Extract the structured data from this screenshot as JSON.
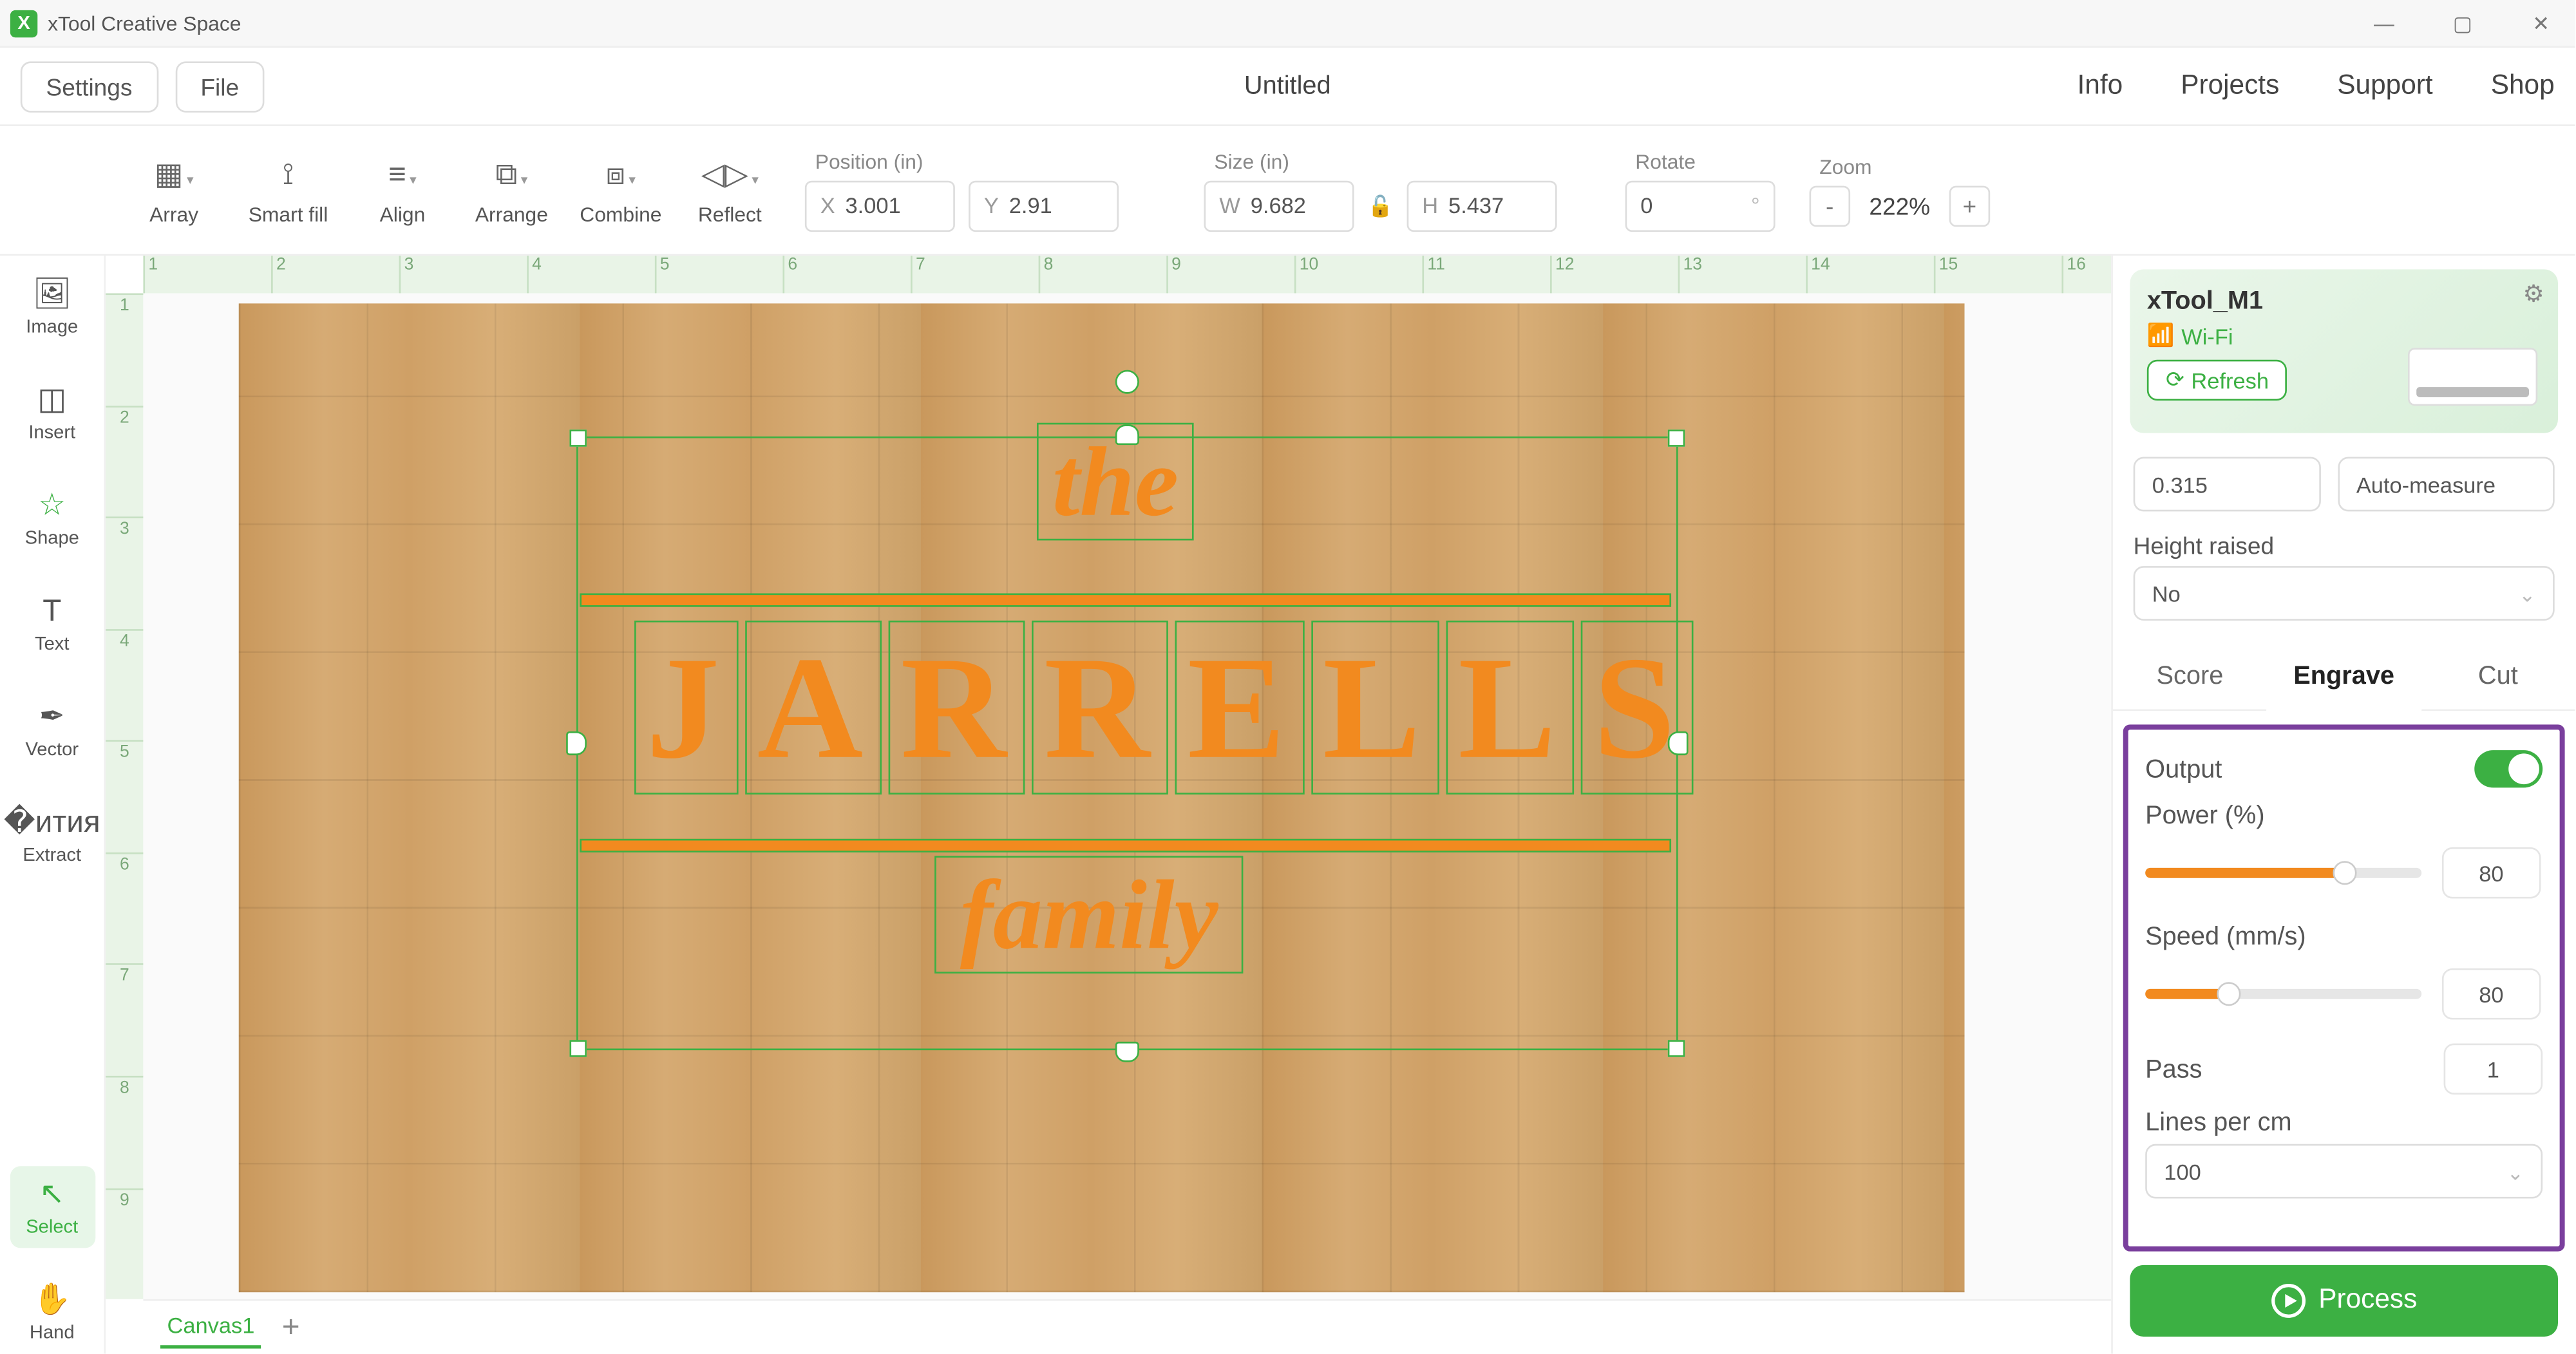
{
  "titlebar": {
    "app_name": "xTool Creative Space"
  },
  "menubar": {
    "settings": "Settings",
    "file": "File",
    "doc_title": "Untitled",
    "links": {
      "info": "Info",
      "projects": "Projects",
      "support": "Support",
      "shop": "Shop"
    }
  },
  "toolbar": {
    "array": "Array",
    "smartfill": "Smart fill",
    "align": "Align",
    "arrange": "Arrange",
    "combine": "Combine",
    "reflect": "Reflect",
    "position_label": "Position (in)",
    "pos_x_prefix": "X",
    "pos_x": "3.001",
    "pos_y_prefix": "Y",
    "pos_y": "2.91",
    "size_label": "Size (in)",
    "size_w_prefix": "W",
    "size_w": "9.682",
    "size_h_prefix": "H",
    "size_h": "5.437",
    "rotate_label": "Rotate",
    "rotate_val": "0",
    "rotate_unit": "°",
    "zoom_label": "Zoom",
    "zoom_val": "222%"
  },
  "lefttools": {
    "image": "Image",
    "insert": "Insert",
    "shape": "Shape",
    "text": "Text",
    "vector": "Vector",
    "extract": "Extract",
    "select": "Select",
    "hand": "Hand"
  },
  "ruler_h": [
    "1",
    "2",
    "3",
    "4",
    "5",
    "6",
    "7",
    "8",
    "9",
    "10",
    "11",
    "12",
    "13",
    "14",
    "15",
    "16"
  ],
  "ruler_v": [
    "1",
    "2",
    "3",
    "4",
    "5",
    "6",
    "7",
    "8",
    "9"
  ],
  "canvas": {
    "text_the": "the",
    "text_main_letters": [
      "J",
      "A",
      "R",
      "R",
      "E",
      "L",
      "L",
      "S"
    ],
    "text_family": "family",
    "tab1": "Canvas1"
  },
  "right": {
    "device_name": "xTool_M1",
    "wifi": "Wi-Fi",
    "refresh": "Refresh",
    "thickness": "0.315",
    "automeasure": "Auto-measure",
    "height_label": "Height raised",
    "height_value": "No",
    "tabs": {
      "score": "Score",
      "engrave": "Engrave",
      "cut": "Cut"
    },
    "output_label": "Output",
    "power_label": "Power (%)",
    "power_val": "80",
    "power_pct": 72,
    "speed_label": "Speed (mm/s)",
    "speed_val": "80",
    "speed_pct": 30,
    "pass_label": "Pass",
    "pass_val": "1",
    "lines_label": "Lines per cm",
    "lines_val": "100",
    "process": "Process"
  }
}
